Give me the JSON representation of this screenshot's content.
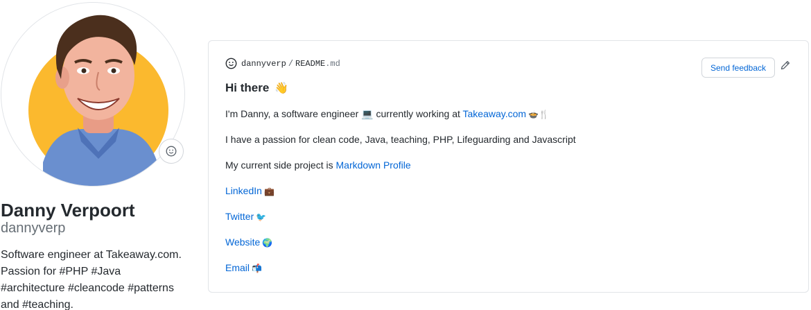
{
  "profile": {
    "full_name": "Danny Verpoort",
    "username": "dannyverp",
    "bio": "Software engineer at Takeaway.com. Passion for #PHP #Java #architecture #cleancode #patterns and #teaching."
  },
  "readme": {
    "owner": "dannyverp",
    "separator": "/",
    "filename": "README",
    "extension": ".md",
    "feedback_label": "Send feedback",
    "title": "Hi there",
    "title_emoji": "👋",
    "line1": {
      "text": "I'm Danny, a software engineer 💻 currently working at ",
      "link": "Takeaway.com",
      "suffix": "🍲🍴"
    },
    "line2": "I have a passion for clean code, Java, teaching, PHP, Lifeguarding and Javascript",
    "line3": {
      "text": "My current side project is ",
      "link": "Markdown Profile"
    },
    "links": [
      {
        "label": "LinkedIn",
        "emoji": "💼"
      },
      {
        "label": "Twitter",
        "emoji": "🐦"
      },
      {
        "label": "Website",
        "emoji": "🌍"
      },
      {
        "label": "Email",
        "emoji": "📬"
      }
    ]
  },
  "colors": {
    "link": "#0366d6",
    "avatar_bg": "#fbb92e",
    "shirt": "#6a8fcf"
  }
}
